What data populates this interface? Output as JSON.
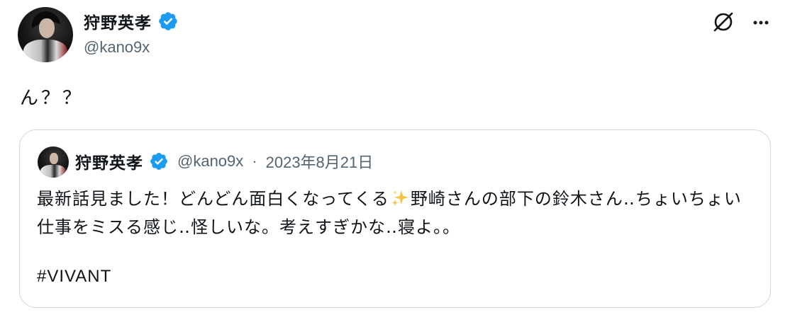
{
  "post": {
    "author": {
      "display_name": "狩野英孝",
      "handle": "@kano9x",
      "verified": true
    },
    "text": "ん？？",
    "icons": {
      "grok": "grok-icon",
      "more": "more-icon",
      "verified": "verified-badge-icon"
    }
  },
  "quoted_post": {
    "author": {
      "display_name": "狩野英孝",
      "handle": "@kano9x",
      "verified": true
    },
    "separator": "·",
    "date": "2023年8月21日",
    "text_before_emoji": "最新話見ました！どんどん面白くなってくる",
    "emoji": "sparkles-icon",
    "text_after_emoji": "野崎さんの部下の鈴木さん‥ちょいちょい仕事をミスる感じ‥怪しいな。考えすぎかな‥寝よ。。",
    "hashtag": "#VIVANT"
  },
  "colors": {
    "text": "#0f1419",
    "secondary_text": "#536471",
    "verified_blue": "#1d9bf0",
    "border": "#cfd9de",
    "sparkle_gold": "#f5c542"
  }
}
